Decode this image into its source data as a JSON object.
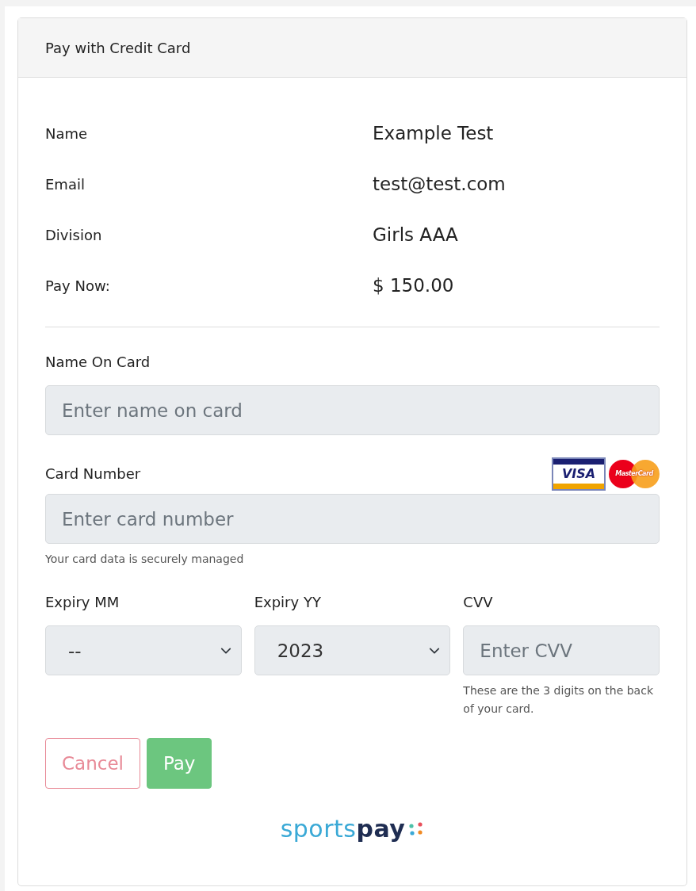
{
  "card_header": {
    "title": "Pay with Credit Card"
  },
  "summary": [
    {
      "label": "Name",
      "value": "Example Test"
    },
    {
      "label": "Email",
      "value": "test@test.com"
    },
    {
      "label": "Division",
      "value": "Girls AAA"
    },
    {
      "label": "Pay Now:",
      "value": "$ 150.00"
    }
  ],
  "name_on_card": {
    "label": "Name On Card",
    "placeholder": "Enter name on card"
  },
  "card_number": {
    "label": "Card Number",
    "placeholder": "Enter card number",
    "help": "Your card data is securely managed",
    "card_logos": [
      "VISA",
      "MasterCard"
    ]
  },
  "expiry_mm": {
    "label": "Expiry MM",
    "value": "--"
  },
  "expiry_yy": {
    "label": "Expiry YY",
    "value": "2023"
  },
  "cvv": {
    "label": "CVV",
    "placeholder": "Enter CVV",
    "help": "These are the 3 digits on the back of your card."
  },
  "buttons": [
    {
      "label": "Cancel",
      "kind": "cancel"
    },
    {
      "label": "Pay",
      "kind": "submit"
    }
  ],
  "brand": "sports**pay**"
}
